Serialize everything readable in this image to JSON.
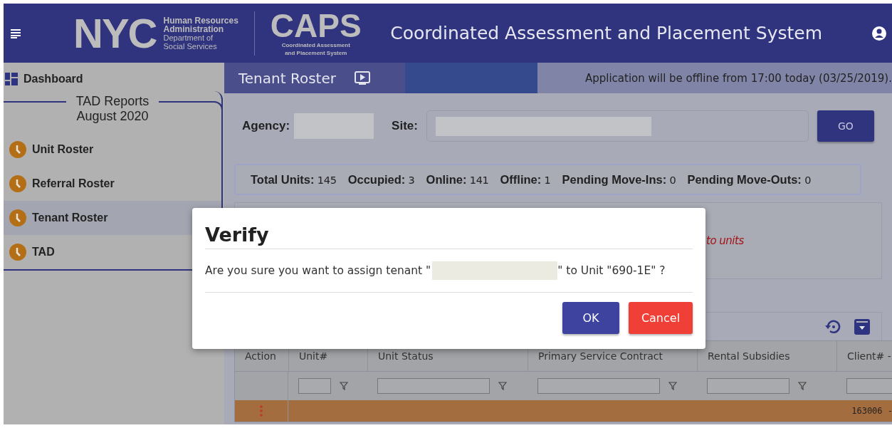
{
  "header": {
    "logo_word": "NYC",
    "logo_lines": [
      "Human Resources",
      "Administration",
      "Department of",
      "Social Services"
    ],
    "caps_word": "CAPS",
    "caps_subtitle": [
      "Coordinated Assessment",
      "and Placement System"
    ],
    "app_title": "Coordinated Assessment and Placement System"
  },
  "sidebar": {
    "dashboard": "Dashboard",
    "group_title": [
      "TAD Reports",
      "August 2020"
    ],
    "items": [
      {
        "label": "Unit Roster",
        "selected": false
      },
      {
        "label": "Referral Roster",
        "selected": false
      },
      {
        "label": "Tenant Roster",
        "selected": true
      },
      {
        "label": "TAD",
        "selected": false
      }
    ]
  },
  "page": {
    "title": "Tenant Roster",
    "notice": "Application will be offline from 17:00 today (03/25/2019).",
    "agency_label": "Agency:",
    "site_label": "Site:",
    "go_button": "GO",
    "stats": [
      {
        "label": "Total Units:",
        "value": "145"
      },
      {
        "label": "Occupied:",
        "value": "3"
      },
      {
        "label": "Online:",
        "value": "141"
      },
      {
        "label": "Offline:",
        "value": "1"
      },
      {
        "label": "Pending Move-Ins:",
        "value": "0"
      },
      {
        "label": "Pending Move-Outs:",
        "value": "0"
      }
    ],
    "message": "to units",
    "table": {
      "columns": [
        {
          "label": "Action",
          "kind": "plain"
        },
        {
          "label": "Unit#",
          "kind": "filtered"
        },
        {
          "label": "Unit Status",
          "kind": "filtered"
        },
        {
          "label": "Primary Service Contract",
          "kind": "filtered"
        },
        {
          "label": "Rental Subsidies",
          "kind": "filtered"
        },
        {
          "label": "Client# -",
          "kind": "input"
        }
      ],
      "rows": [
        {
          "highlighted": true,
          "client": "163006 -"
        }
      ]
    }
  },
  "dialog": {
    "title": "Verify",
    "message_before": "Are you sure you want to assign tenant \"",
    "message_after": "\" to Unit \"690-1E\" ?",
    "buttons": [
      {
        "label": "OK",
        "kind": "primary"
      },
      {
        "label": "Cancel",
        "kind": "danger"
      }
    ]
  }
}
